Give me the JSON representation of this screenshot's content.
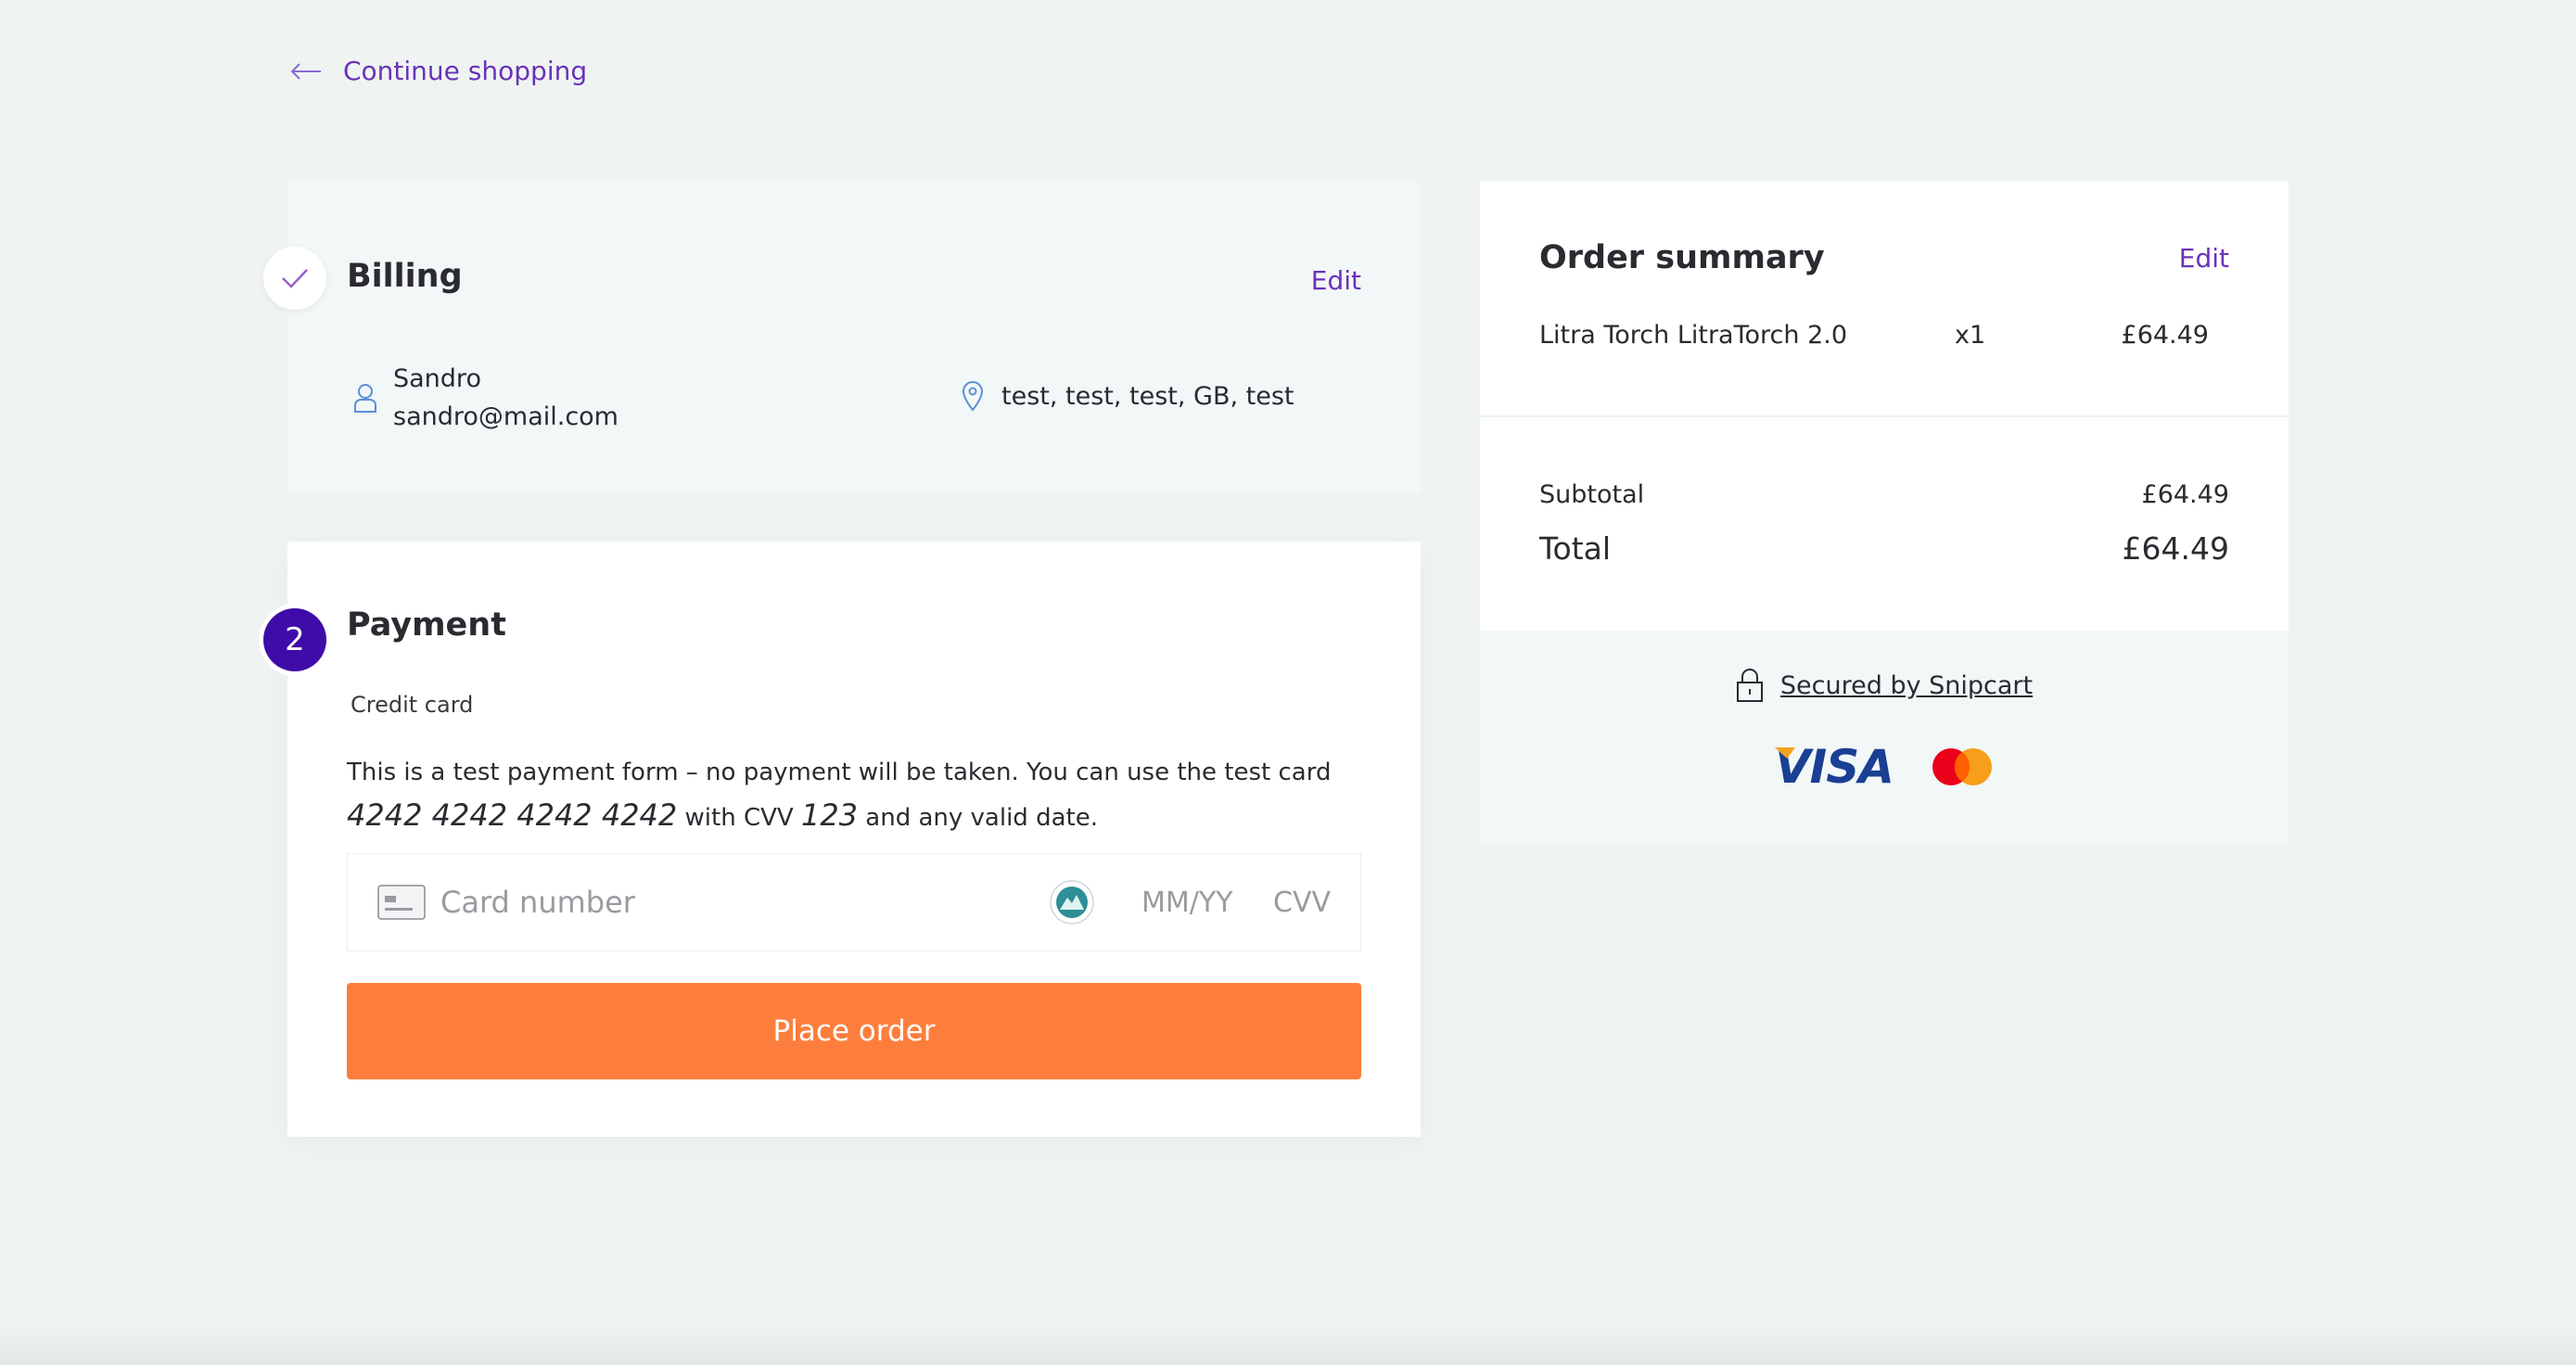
{
  "nav": {
    "continue_shopping": "Continue shopping"
  },
  "billing": {
    "title": "Billing",
    "edit_label": "Edit",
    "name": "Sandro",
    "email": "sandro@mail.com",
    "address": "test, test, test, GB, test",
    "step_icon": "check-icon"
  },
  "payment": {
    "step_number": "2",
    "title": "Payment",
    "method": "Credit card",
    "note_prefix": "This is a test payment form – no payment will be taken. You can use the test card ",
    "test_card": "4242 4242 4242 4242",
    "note_mid": " with CVV ",
    "test_cvv": "123",
    "note_suffix": " and any valid date.",
    "card_placeholder": "Card number",
    "expiry_placeholder": "MM/YY",
    "cvv_placeholder": "CVV",
    "place_order_label": "Place order"
  },
  "summary": {
    "title": "Order summary",
    "edit_label": "Edit",
    "items": [
      {
        "name": "Litra Torch LitraTorch 2.0",
        "qty": "x1",
        "price": "£64.49"
      }
    ],
    "subtotal_label": "Subtotal",
    "subtotal_value": "£64.49",
    "total_label": "Total",
    "total_value": "£64.49",
    "secured_label": "Secured by Snipcart",
    "card_brands": [
      "VISA",
      "Mastercard"
    ]
  },
  "colors": {
    "background": "#eff4f3",
    "accent_purple": "#6a32b8",
    "step_active": "#3f0ca8",
    "place_order": "#fd7e3c",
    "visa_blue": "#1a3f93"
  }
}
